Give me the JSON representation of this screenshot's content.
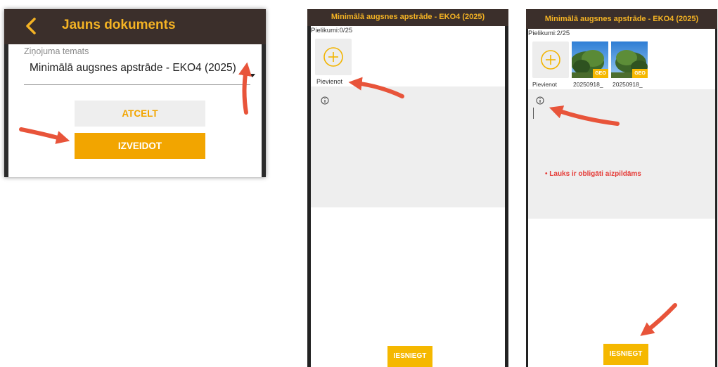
{
  "colors": {
    "accent": "#f2a500",
    "header_bg": "#3b2f2b",
    "header_text": "#f4b324",
    "error": "#e53935",
    "annotation_arrow": "#e8543a"
  },
  "panel1": {
    "header": {
      "back_icon": "chevron-left-icon",
      "title": "Jauns dokuments"
    },
    "field": {
      "label": "Ziņojuma temats",
      "value": "Minimālā augsnes apstrāde - EKO4 (2025)",
      "dropdown_icon": "caret-down-icon"
    },
    "buttons": {
      "cancel": "ATCELT",
      "create": "IZVEIDOT"
    }
  },
  "panel2": {
    "title": "Minimālā augsnes apstrāde - EKO4 (2025)",
    "attachments_counter": "Pielikumi:0/25",
    "add_label": "Pievienot",
    "info_icon": "info-icon",
    "submit": "IESNIEGT"
  },
  "panel3": {
    "title": "Minimālā augsnes apstrāde - EKO4 (2025)",
    "attachments_counter": "Pielikumi:2/25",
    "add_label": "Pievienot",
    "photos": [
      {
        "label": "20250918_",
        "badge": "GEO"
      },
      {
        "label": "20250918_",
        "badge": "GEO"
      }
    ],
    "info_icon": "info-icon",
    "error": "• Lauks ir obligāti aizpildāms",
    "submit": "IESNIEGT"
  }
}
